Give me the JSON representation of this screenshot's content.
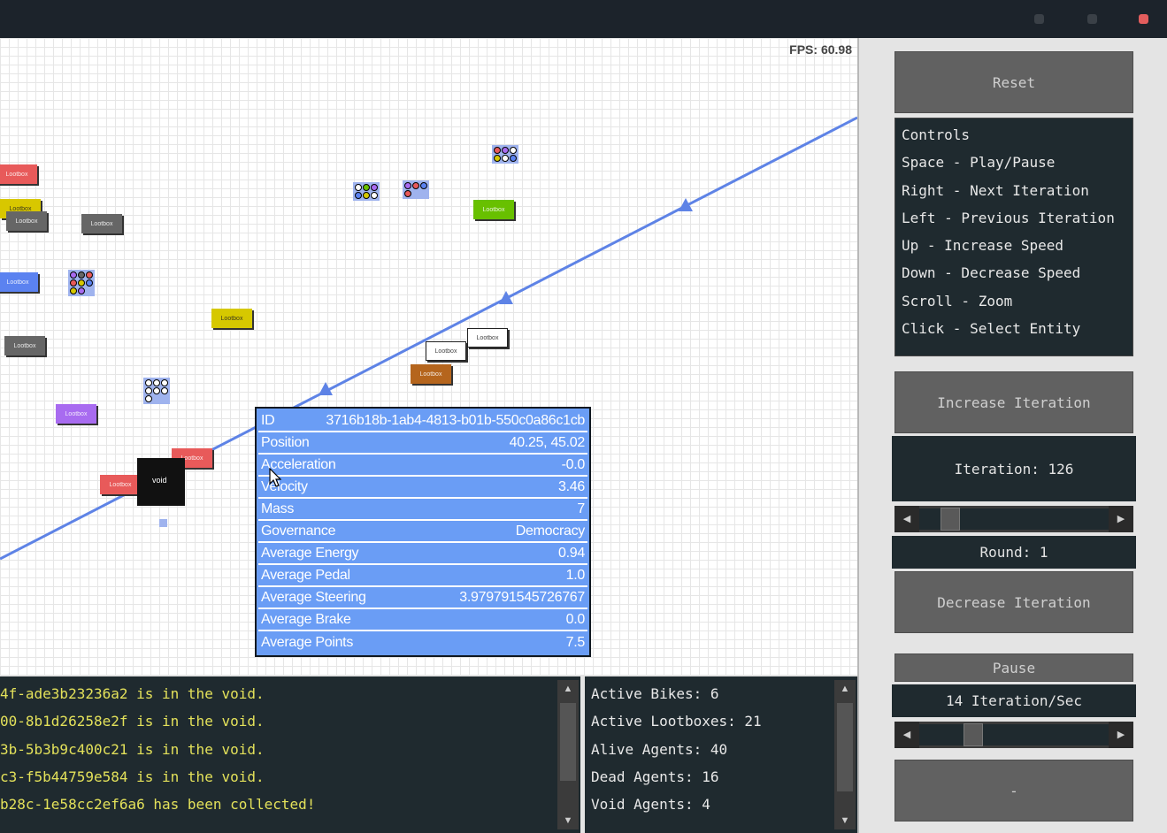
{
  "window": {
    "controls": [
      {
        "name": "minimize",
        "color": "#3a4047"
      },
      {
        "name": "maximize",
        "color": "#3a4047"
      },
      {
        "name": "close",
        "color": "#e25d5d"
      }
    ]
  },
  "canvas": {
    "fps_label": "FPS: 60.98",
    "lootbox_label": "Lootbox",
    "void_label": "void",
    "lootboxes": [
      {
        "color": "#e85a5a",
        "label": "Lootbox"
      },
      {
        "color": "#d8c700",
        "label": "Lootbox"
      },
      {
        "color": "#666666",
        "label": "Lootbox"
      },
      {
        "color": "#666666",
        "label": "Lootbox"
      },
      {
        "color": "#5b82f0",
        "label": "Lootbox"
      },
      {
        "color": "#666666",
        "label": "Lootbox"
      },
      {
        "color": "#d6c800",
        "label": "Lootbox"
      },
      {
        "color": "#a86bf0",
        "label": "Lootbox"
      },
      {
        "color": "#68c000",
        "label": "Lootbox"
      },
      {
        "color": "#ffffff",
        "label": "Lootbox"
      },
      {
        "color": "#ffffff",
        "label": "Lootbox"
      },
      {
        "color": "#b5651d",
        "label": "Lootbox"
      },
      {
        "color": "#e85a5a",
        "label": "Lootbox"
      },
      {
        "color": "#e85a5a",
        "label": "Lootbox"
      }
    ]
  },
  "tooltip": {
    "rows": [
      {
        "key": "ID",
        "value": "3716b18b-1ab4-4813-b01b-550c0a86c1cb"
      },
      {
        "key": "Position",
        "value": "40.25, 45.02"
      },
      {
        "key": "Acceleration",
        "value": "-0.0"
      },
      {
        "key": "Velocity",
        "value": "3.46"
      },
      {
        "key": "Mass",
        "value": "7"
      },
      {
        "key": "Governance",
        "value": "Democracy"
      },
      {
        "key": "Average Energy",
        "value": "0.94"
      },
      {
        "key": "Average Pedal",
        "value": "1.0"
      },
      {
        "key": "Average Steering",
        "value": "3.979791545726767"
      },
      {
        "key": "Average Brake",
        "value": "0.0"
      },
      {
        "key": "Average Points",
        "value": "7.5"
      }
    ]
  },
  "log": {
    "lines": [
      "4f-ade3b23236a2 is in the void.",
      "00-8b1d26258e2f is in the void.",
      "3b-5b3b9c400c21 is in the void.",
      "c3-f5b44759e584 is in the void.",
      "b28c-1e58cc2ef6a6 has been collected!"
    ]
  },
  "stats": {
    "lines": [
      "Active Bikes: 6",
      "Active Lootboxes: 21",
      "Alive Agents: 40",
      "Dead Agents: 16",
      "Void Agents: 4"
    ]
  },
  "sidebar": {
    "reset_label": "Reset",
    "controls": [
      "Controls",
      "Space - Play/Pause",
      "Right - Next Iteration",
      "Left - Previous Iteration",
      "Up - Increase Speed",
      "Down - Decrease Speed",
      "Scroll - Zoom",
      "Click - Select Entity"
    ],
    "increase_label": "Increase Iteration",
    "iteration_label": "Iteration: 126",
    "round_label": "Round: 1",
    "decrease_label": "Decrease Iteration",
    "pause_label": "Pause",
    "speed_label": "14 Iteration/Sec",
    "bottom_label": "-",
    "arrow_left": "◀",
    "arrow_right": "▶",
    "arrow_up": "▲",
    "arrow_down": "▼"
  }
}
